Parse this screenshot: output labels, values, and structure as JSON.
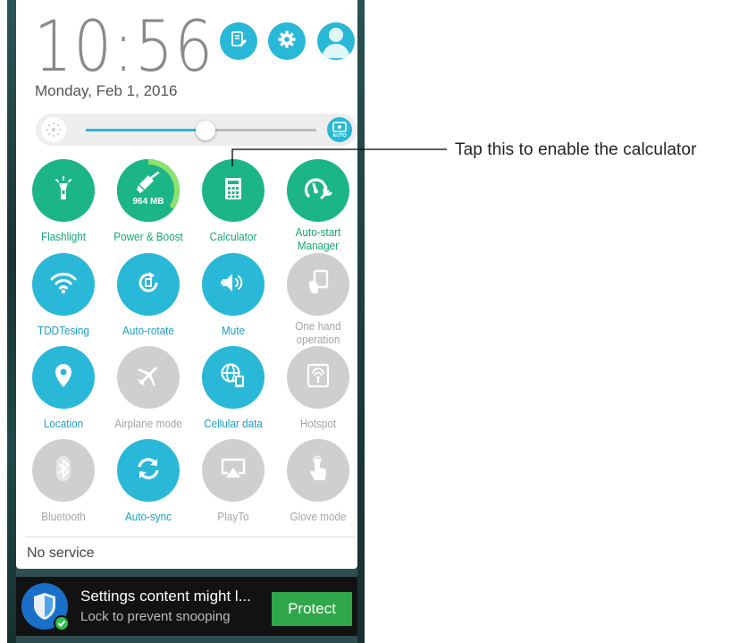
{
  "clock": {
    "time": "10:56",
    "date": "Monday, Feb 1, 2016"
  },
  "header_buttons": [
    {
      "name": "edit-icon"
    },
    {
      "name": "gear-icon"
    },
    {
      "name": "avatar-icon"
    }
  ],
  "brightness": {
    "level": 0.52,
    "auto_label": "AUTO"
  },
  "tiles": {
    "flashlight": {
      "label": "Flashlight",
      "state": "on",
      "icon": "flashlight-icon"
    },
    "power_boost": {
      "label": "Power & Boost",
      "state": "on",
      "icon": "broom-icon",
      "ram": "964 MB",
      "ring_fraction": 0.35
    },
    "calculator": {
      "label": "Calculator",
      "state": "on",
      "icon": "calculator-icon"
    },
    "autostart": {
      "label": "Auto-start\nManager",
      "state": "on",
      "icon": "gauge-wrench-icon"
    },
    "wifi": {
      "label": "TDDTesing",
      "state": "on",
      "icon": "wifi-icon"
    },
    "autorotate": {
      "label": "Auto-rotate",
      "state": "on",
      "icon": "rotate-icon"
    },
    "mute": {
      "label": "Mute",
      "state": "on",
      "icon": "speaker-icon"
    },
    "onehand": {
      "label": "One hand\noperation",
      "state": "off",
      "icon": "one-hand-icon"
    },
    "location": {
      "label": "Location",
      "state": "on",
      "icon": "location-pin-icon"
    },
    "airplane": {
      "label": "Airplane mode",
      "state": "off",
      "icon": "airplane-icon"
    },
    "cellular": {
      "label": "Cellular data",
      "state": "on",
      "icon": "globe-phone-icon"
    },
    "hotspot": {
      "label": "Hotspot",
      "state": "off",
      "icon": "hotspot-icon"
    },
    "bluetooth": {
      "label": "Bluetooth",
      "state": "off",
      "icon": "bluetooth-icon"
    },
    "autosync": {
      "label": "Auto-sync",
      "state": "on",
      "icon": "sync-icon"
    },
    "playto": {
      "label": "PlayTo",
      "state": "off",
      "icon": "cast-icon"
    },
    "glove": {
      "label": "Glove mode",
      "state": "off",
      "icon": "glove-icon"
    }
  },
  "status": {
    "network": "No service"
  },
  "notification": {
    "title": "Settings content might l...",
    "subtitle": "Lock to prevent snooping",
    "button": "Protect",
    "icon": "shield-icon"
  },
  "callout": {
    "text": "Tap this to enable the calculator"
  },
  "colors": {
    "accent_blue": "#29b8d8",
    "accent_green": "#1cb587",
    "inactive_gray": "#cfcfcf",
    "protect_green": "#2fa74a"
  }
}
